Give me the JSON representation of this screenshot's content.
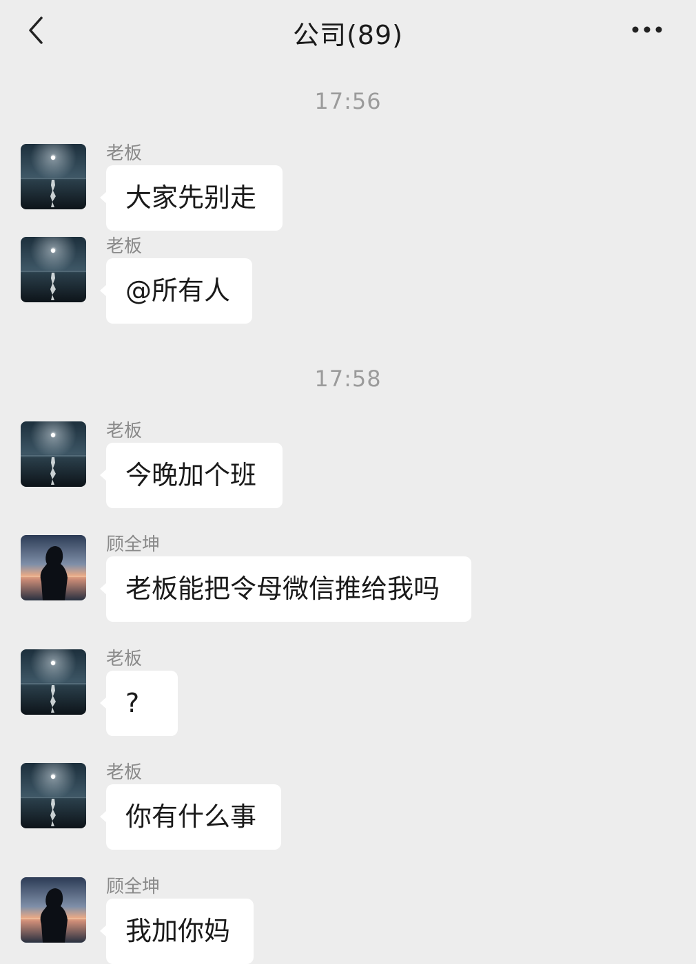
{
  "header": {
    "title": "公司(89)",
    "back_icon": "chevron-left-icon",
    "more_icon": "ellipsis-icon"
  },
  "timestamps": [
    "17:56",
    "17:58"
  ],
  "messages": [
    {
      "sender": "老板",
      "text": "大家先别走",
      "avatar": "moon-sea-avatar"
    },
    {
      "sender": "老板",
      "text": "@所有人",
      "avatar": "moon-sea-avatar"
    },
    {
      "sender": "老板",
      "text": "今晚加个班",
      "avatar": "moon-sea-avatar"
    },
    {
      "sender": "顾全坤",
      "text": "老板能把令母微信推给我吗",
      "avatar": "silhouette-avatar"
    },
    {
      "sender": "老板",
      "text": "?",
      "avatar": "moon-sea-avatar"
    },
    {
      "sender": "老板",
      "text": "你有什么事",
      "avatar": "moon-sea-avatar"
    },
    {
      "sender": "顾全坤",
      "text": "我加你妈",
      "avatar": "silhouette-avatar"
    }
  ],
  "colors": {
    "background": "#ededed",
    "bubble": "#ffffff",
    "sender_name": "#8a8a8a",
    "timestamp": "#9b9b9b"
  }
}
